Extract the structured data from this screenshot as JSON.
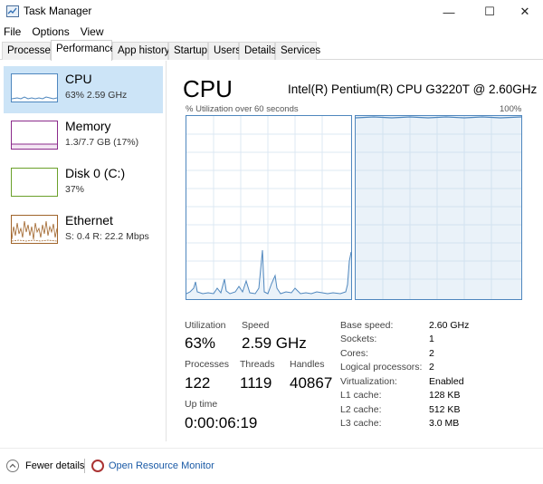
{
  "window": {
    "title": "Task Manager",
    "minimize_glyph": "—",
    "maximize_glyph": "☐",
    "close_glyph": "✕"
  },
  "menu": [
    "File",
    "Options",
    "View"
  ],
  "tabs": [
    {
      "label": "Processes"
    },
    {
      "label": "Performance",
      "active": true
    },
    {
      "label": "App history"
    },
    {
      "label": "Startup"
    },
    {
      "label": "Users"
    },
    {
      "label": "Details"
    },
    {
      "label": "Services"
    }
  ],
  "sidebar": {
    "items": [
      {
        "title": "CPU",
        "subtitle": "63%  2.59 GHz",
        "color": "#4f87be",
        "selected": true
      },
      {
        "title": "Memory",
        "subtitle": "1.3/7.7 GB (17%)",
        "color": "#8b2a8b"
      },
      {
        "title": "Disk 0 (C:)",
        "subtitle": "37%",
        "color": "#6aa02a"
      },
      {
        "title": "Ethernet",
        "subtitle": "S: 0.4  R: 22.2 Mbps",
        "color": "#a0642a"
      }
    ]
  },
  "cpu": {
    "title": "CPU",
    "model": "Intel(R) Pentium(R) CPU G3220T @ 2.60GHz",
    "graph_label": "% Utilization over 60 seconds",
    "graph_max": "100%",
    "graph_color": "#4f87be"
  },
  "stats": {
    "utilization": {
      "label": "Utilization",
      "value": "63%"
    },
    "speed": {
      "label": "Speed",
      "value": "2.59 GHz"
    },
    "processes": {
      "label": "Processes",
      "value": "122"
    },
    "threads": {
      "label": "Threads",
      "value": "1119"
    },
    "handles": {
      "label": "Handles",
      "value": "40867"
    },
    "uptime": {
      "label": "Up time",
      "value": "0:00:06:19"
    }
  },
  "details": [
    {
      "key": "Base speed:",
      "value": "2.60 GHz"
    },
    {
      "key": "Sockets:",
      "value": "1"
    },
    {
      "key": "Cores:",
      "value": "2"
    },
    {
      "key": "Logical processors:",
      "value": "2"
    },
    {
      "key": "Virtualization:",
      "value": "Enabled"
    },
    {
      "key": "L1 cache:",
      "value": "128 KB"
    },
    {
      "key": "L2 cache:",
      "value": "512 KB"
    },
    {
      "key": "L3 cache:",
      "value": "3.0 MB"
    }
  ],
  "footer": {
    "fewer_details": "Fewer details",
    "resource_monitor": "Open Resource Monitor"
  }
}
